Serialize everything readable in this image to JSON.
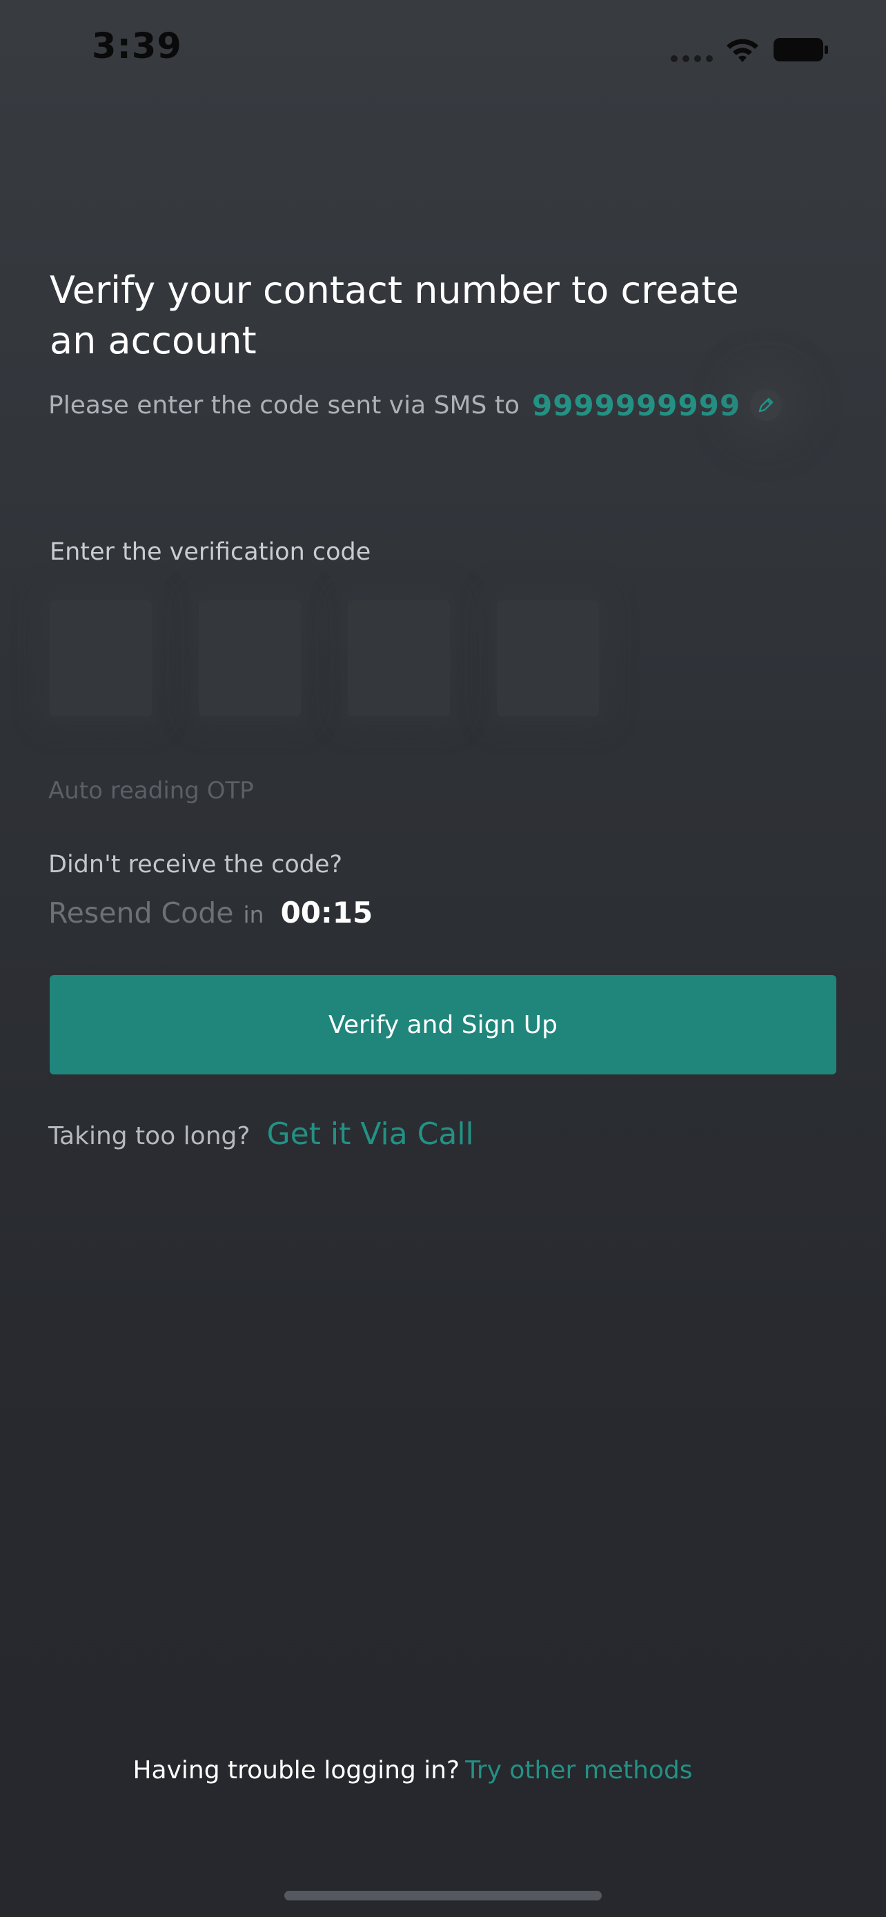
{
  "status_bar": {
    "time": "3:39",
    "icons": [
      "signal-icon",
      "wifi-icon",
      "battery-icon"
    ]
  },
  "header": {
    "title": "Verify your contact number to create an account",
    "subtitle": "Please enter the code sent via SMS to",
    "phone_number": "9999999999",
    "edit_icon": "pencil-icon"
  },
  "otp": {
    "label": "Enter the verification code",
    "digits": [
      "",
      "",
      "",
      ""
    ],
    "auto_read_text": "Auto reading OTP"
  },
  "resend": {
    "question": "Didn't receive the code?",
    "resend_label": "Resend Code",
    "in_label": "in",
    "timer": "00:15"
  },
  "verify_button": {
    "label": "Verify and Sign Up"
  },
  "call": {
    "question": "Taking too long?",
    "link": "Get it Via Call"
  },
  "footer": {
    "trouble_text": "Having trouble logging in?",
    "trouble_link": "Try other methods"
  },
  "colors": {
    "accent": "#20867c",
    "link": "#239184",
    "background": "#2e3136"
  }
}
